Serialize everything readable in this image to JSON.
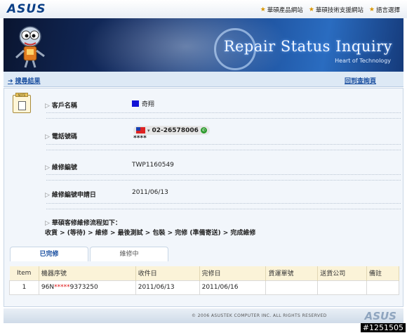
{
  "brand": {
    "logo": "ASUS",
    "footer_logo": "ASUS"
  },
  "top_links": [
    {
      "label": "華碩產品網站"
    },
    {
      "label": "華碩技術支援網站"
    },
    {
      "label": "語言選擇"
    }
  ],
  "banner": {
    "title": "Repair Status Inquiry",
    "subtitle": "Heart of Technology"
  },
  "nav": {
    "results_link": "搜尋結果",
    "back_link": "回到查詢頁"
  },
  "fields": {
    "customer_name_label": "客戶名稱",
    "customer_name_value": "     奇翔",
    "phone_label": "電話號碼",
    "phone_value": "02-26578006",
    "phone_masked": "****",
    "repair_no_label": "維修編號",
    "repair_no_value": "TWP1160549",
    "apply_date_label": "維修編號申請日",
    "apply_date_value": "2011/06/13",
    "process_label": "華碩客修維修流程如下：",
    "process_steps": "收貨 > (等待) > 維修 > 最後測試 > 包裝 > 完修 (準備寄送) > 完成維修"
  },
  "tabs": [
    {
      "label": "已完修",
      "active": true
    },
    {
      "label": "維修中",
      "active": false
    }
  ],
  "table": {
    "headers": [
      "Item",
      "機器序號",
      "收件日",
      "完修日",
      "貨運單號",
      "送貨公司",
      "備註"
    ],
    "rows": [
      {
        "item": "1",
        "serial_prefix": "96N",
        "serial_mask": "*****",
        "serial_suffix": "9373250",
        "received": "2011/06/13",
        "completed": "2011/06/16",
        "tracking": "",
        "courier": "",
        "note": ""
      }
    ]
  },
  "footer": {
    "copyright": "© 2006 ASUSTEK COMPUTER INC. ALL RIGHTS RESERVED"
  },
  "badge": "#1251505"
}
